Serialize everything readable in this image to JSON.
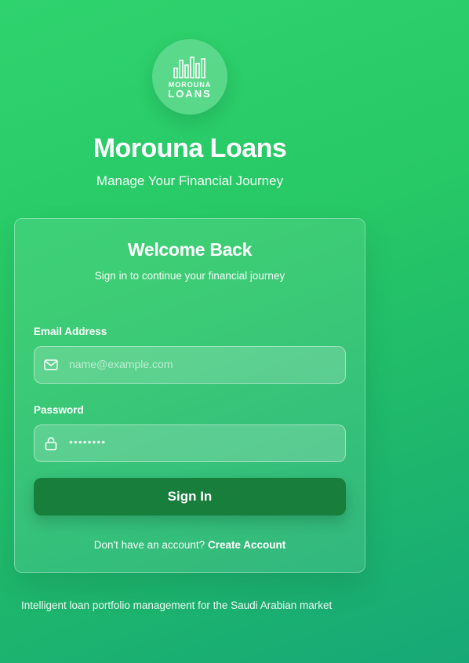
{
  "brand": {
    "logo_text_top": "MOROUNA",
    "logo_text_bottom": "LOANS",
    "logo_icon": "bar-chart-logo-icon",
    "title": "Morouna Loans",
    "subtitle": "Manage Your Financial Journey"
  },
  "card": {
    "title": "Welcome Back",
    "subtitle": "Sign in to continue your financial journey",
    "email": {
      "label": "Email Address",
      "placeholder": "name@example.com",
      "icon": "mail-icon"
    },
    "password": {
      "label": "Password",
      "value": "••••••••",
      "icon": "lock-icon"
    },
    "signin_label": "Sign In",
    "signup_prompt": "Don't have an account?",
    "signup_link": "Create Account"
  },
  "footer": {
    "text": "Intelligent loan portfolio management for the Saudi Arabian market"
  },
  "colors": {
    "background_start": "#2fd36e",
    "background_end": "#17a877",
    "button": "#177e3c",
    "text": "#ffffff"
  }
}
